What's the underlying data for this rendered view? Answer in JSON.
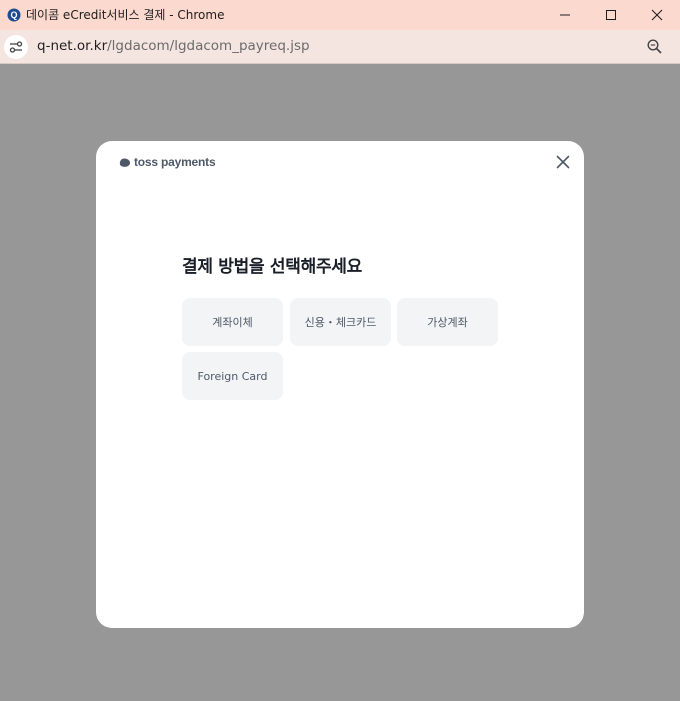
{
  "window": {
    "title": "데이콤 eCredit서비스 결제 - Chrome",
    "app_icon": "q-net-favicon",
    "controls": [
      "minimize-icon",
      "maximize-icon",
      "close-icon"
    ]
  },
  "address_bar": {
    "host": "q-net.or.kr",
    "path": "/lgdacom/lgdacom_payreq.jsp",
    "icons": [
      "site-info-icon",
      "zoom-icon"
    ]
  },
  "dialog": {
    "logo_text": "toss payments",
    "heading": "결제 방법을 선택해주세요",
    "payment_methods": [
      {
        "label": "계좌이체"
      },
      {
        "label": "신용・체크카드"
      },
      {
        "label": "가상계좌"
      },
      {
        "label": "Foreign Card"
      }
    ]
  },
  "colors": {
    "title_bar": "#fcd9ce",
    "address_bar": "#f5e5e1",
    "overlay": "#979797",
    "dialog_bg": "#ffffff",
    "button_bg": "#f2f4f6",
    "button_text": "#4e5968",
    "heading_text": "#191f28"
  }
}
